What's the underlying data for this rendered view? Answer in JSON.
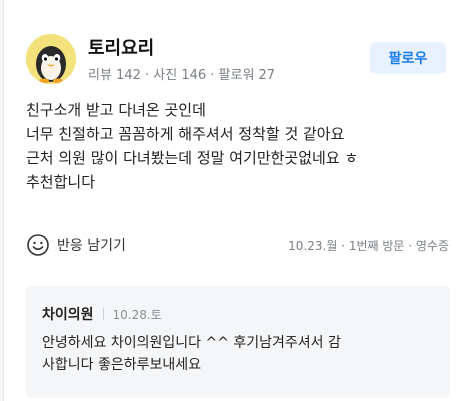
{
  "user": {
    "nickname": "토리요리",
    "stats": "리뷰 142 · 사진 146 · 팔로워 27",
    "follow_label": "팔로우"
  },
  "review": {
    "lines": [
      "친구소개 받고 다녀온 곳인데",
      "너무 친절하고 꼼꼼하게 해주셔서 정착할 것 같아요",
      "근처 의원 많이 다녀봤는데 정말 여기만한곳없네요 ㅎ",
      "추천합니다"
    ],
    "reaction_label": "반응 남기기",
    "meta": "10.23.월 · 1번째 방문 · 영수증"
  },
  "reply": {
    "author": "차이의원",
    "date": "10.28.토",
    "lines": [
      "안녕하세요 차이의원입니다 ^^ 후기남겨주셔서 감",
      "사합니다 좋은하루보내세요"
    ]
  },
  "colors": {
    "follow_bg": "#e8f1ff",
    "follow_text": "#1b7cf0",
    "meta_gray": "#7a7f86",
    "reply_bg": "#f5f6f8"
  }
}
